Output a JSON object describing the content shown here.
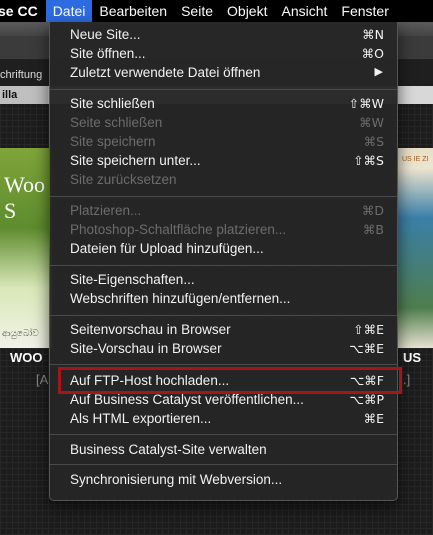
{
  "menubar": {
    "app_title": "se CC",
    "menus": [
      {
        "label": "Datei",
        "active": true
      },
      {
        "label": "Bearbeiten",
        "active": false
      },
      {
        "label": "Seite",
        "active": false
      },
      {
        "label": "Objekt",
        "active": false
      },
      {
        "label": "Ansicht",
        "active": false
      },
      {
        "label": "Fenster",
        "active": false
      }
    ]
  },
  "background": {
    "toolbar_label": "chriftung",
    "panel_label": "illa",
    "thumb_left_text": "Woo\nS",
    "thumb_right_text": "US  IE ZI",
    "thumb_left_footer": "ආයුබෝව",
    "caption_left": "WOO",
    "caption_left_sub": "[A",
    "caption_right": "US",
    "caption_right_sub": ".]"
  },
  "file_menu": {
    "items": [
      {
        "label": "Neue Site...",
        "shortcut": "⌘N",
        "disabled": false
      },
      {
        "label": "Site öffnen...",
        "shortcut": "⌘O",
        "disabled": false
      },
      {
        "label": "Zuletzt verwendete Datei öffnen",
        "shortcut": "",
        "submenu": true,
        "disabled": false
      },
      {
        "label": "Site schließen",
        "shortcut": "⇧⌘W",
        "disabled": false
      },
      {
        "label": "Seite schließen",
        "shortcut": "⌘W",
        "disabled": true
      },
      {
        "label": "Site speichern",
        "shortcut": "⌘S",
        "disabled": true
      },
      {
        "label": "Site speichern unter...",
        "shortcut": "⇧⌘S",
        "disabled": false
      },
      {
        "label": "Site zurücksetzen",
        "shortcut": "",
        "disabled": true
      },
      {
        "label": "Platzieren...",
        "shortcut": "⌘D",
        "disabled": true
      },
      {
        "label": "Photoshop-Schaltfläche platzieren...",
        "shortcut": "⌘B",
        "disabled": true
      },
      {
        "label": "Dateien für Upload hinzufügen...",
        "shortcut": "",
        "disabled": false
      },
      {
        "label": "Site-Eigenschaften...",
        "shortcut": "",
        "disabled": false
      },
      {
        "label": "Webschriften hinzufügen/entfernen...",
        "shortcut": "",
        "disabled": false
      },
      {
        "label": "Seitenvorschau in Browser",
        "shortcut": "⇧⌘E",
        "disabled": false
      },
      {
        "label": "Site-Vorschau in Browser",
        "shortcut": "⌥⌘E",
        "disabled": false
      },
      {
        "label": "Auf FTP-Host hochladen...",
        "shortcut": "⌥⌘F",
        "disabled": false,
        "highlighted": true
      },
      {
        "label": "Auf Business Catalyst veröffentlichen...",
        "shortcut": "⌥⌘P",
        "disabled": false
      },
      {
        "label": "Als HTML exportieren...",
        "shortcut": "⌘E",
        "disabled": false
      },
      {
        "label": "Business Catalyst-Site verwalten",
        "shortcut": "",
        "disabled": false
      },
      {
        "label": "Synchronisierung mit Webversion...",
        "shortcut": "",
        "disabled": false
      }
    ],
    "submenu_arrow": "▶"
  },
  "colors": {
    "menubar_bg": "#000000",
    "active_menu": "#2d6be0",
    "menu_bg": "#262626",
    "disabled_text": "#6c6c6c",
    "highlight_border": "#a3161b"
  }
}
